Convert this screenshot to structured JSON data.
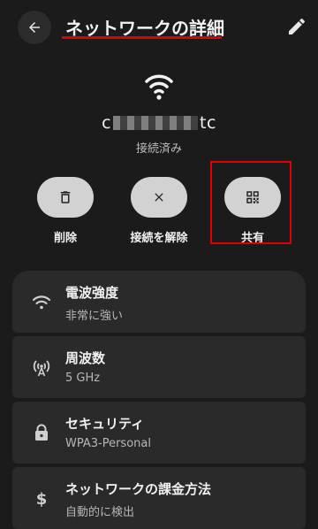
{
  "header": {
    "title": "ネットワークの詳細",
    "back_icon": "arrow-left-icon",
    "edit_icon": "pencil-icon"
  },
  "network": {
    "ssid_prefix": "c",
    "ssid_suffix": "tc",
    "status": "接続済み"
  },
  "actions": {
    "delete_label": "削除",
    "disconnect_label": "接続を解除",
    "share_label": "共有"
  },
  "details": [
    {
      "title": "電波強度",
      "value": "非常に強い",
      "icon": "wifi-signal-icon"
    },
    {
      "title": "周波数",
      "value": "5 GHz",
      "icon": "antenna-icon"
    },
    {
      "title": "セキュリティ",
      "value": "WPA3-Personal",
      "icon": "lock-icon"
    },
    {
      "title": "ネットワークの課金方法",
      "value": "自動的に検出",
      "icon": "dollar-icon"
    }
  ],
  "colors": {
    "background": "#1b1b1b",
    "highlight": "#e00000",
    "button": "#d2d2d2"
  }
}
